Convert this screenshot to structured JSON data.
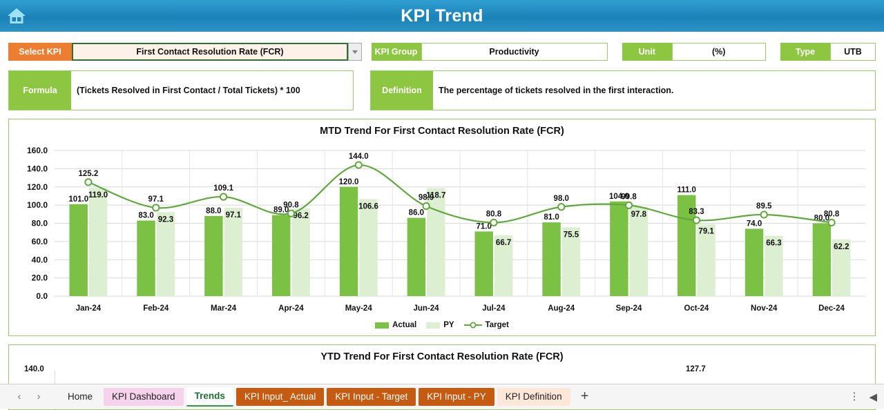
{
  "header": {
    "title": "KPI Trend",
    "home_icon": "home-icon"
  },
  "selectors": {
    "select_kpi_label": "Select KPI",
    "select_kpi_value": "First Contact Resolution Rate (FCR)",
    "kpi_group_label": "KPI Group",
    "kpi_group_value": "Productivity",
    "unit_label": "Unit",
    "unit_value": "(%)",
    "type_label": "Type",
    "type_value": "UTB"
  },
  "meta": {
    "formula_label": "Formula",
    "formula_value": "(Tickets Resolved in First Contact / Total Tickets) * 100",
    "definition_label": "Definition",
    "definition_value": "The percentage of tickets resolved in the first interaction."
  },
  "ytd": {
    "title": "YTD Trend For First Contact Resolution Rate (FCR)",
    "first_tick": "140.0",
    "visible_label": "127.7"
  },
  "tabs": {
    "prev_icon": "chevron-left-icon",
    "next_icon": "chevron-right-icon",
    "items": [
      {
        "label": "Home",
        "style": "plain"
      },
      {
        "label": "KPI Dashboard",
        "style": "pink"
      },
      {
        "label": "Trends",
        "style": "active"
      },
      {
        "label": "KPI Input_ Actual",
        "style": "orange"
      },
      {
        "label": "KPI Input - Target",
        "style": "orange"
      },
      {
        "label": "KPI Input - PY",
        "style": "orange"
      },
      {
        "label": "KPI Definition",
        "style": "peach"
      }
    ],
    "add_label": "+",
    "menu_icon": "vertical-dots-icon"
  },
  "colors": {
    "actual": "#7BC143",
    "py": "#DCEFD0",
    "target": "#5FA83C",
    "header_green": "#8DC641",
    "header_orange": "#ED7D31"
  },
  "chart_data": {
    "type": "bar",
    "title": "MTD Trend For First Contact Resolution Rate (FCR)",
    "xlabel": "",
    "ylabel": "",
    "ylim": [
      0,
      160
    ],
    "yticks": [
      "0.0",
      "20.0",
      "40.0",
      "60.0",
      "80.0",
      "100.0",
      "120.0",
      "140.0",
      "160.0"
    ],
    "grid": true,
    "legend_position": "bottom",
    "categories": [
      "Jan-24",
      "Feb-24",
      "Mar-24",
      "Apr-24",
      "May-24",
      "Jun-24",
      "Jul-24",
      "Aug-24",
      "Sep-24",
      "Oct-24",
      "Nov-24",
      "Dec-24"
    ],
    "series": [
      {
        "name": "Actual",
        "type": "bar",
        "values": [
          101.0,
          83.0,
          88.0,
          89.0,
          120.0,
          86.0,
          71.0,
          81.0,
          104.0,
          111.0,
          74.0,
          80.0
        ]
      },
      {
        "name": "PY",
        "type": "bar",
        "values": [
          119.0,
          92.3,
          97.1,
          96.2,
          106.6,
          118.7,
          66.7,
          75.5,
          97.8,
          79.1,
          66.3,
          62.2
        ]
      },
      {
        "name": "Target",
        "type": "line",
        "values": [
          125.2,
          97.1,
          109.1,
          90.8,
          144.0,
          98.9,
          80.8,
          98.0,
          99.8,
          83.3,
          89.5,
          80.8
        ]
      }
    ]
  }
}
